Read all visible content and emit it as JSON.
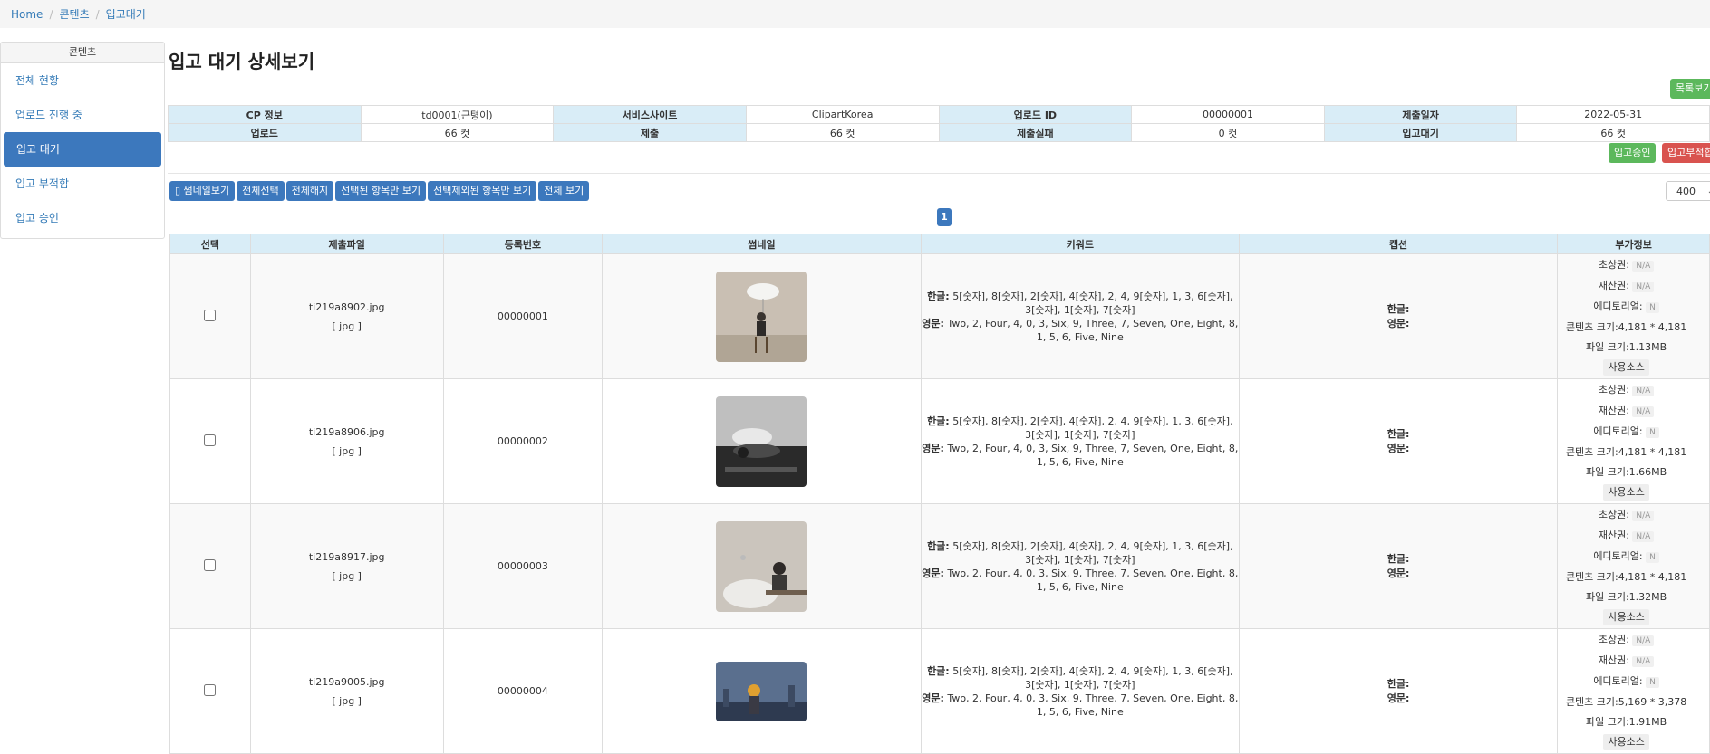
{
  "breadcrumb": {
    "home": "Home",
    "contents": "콘텐츠",
    "current": "입고대기"
  },
  "sidebar": {
    "header": "콘텐츠",
    "items": [
      {
        "label": "전체 현황"
      },
      {
        "label": "업로드 진행 중"
      },
      {
        "label": "입고 대기"
      },
      {
        "label": "입고 부적합"
      },
      {
        "label": "입고 승인"
      }
    ]
  },
  "page": {
    "title": "입고 대기 상세보기",
    "list_button": "목록보기"
  },
  "info": {
    "cp_label": "CP 정보",
    "cp_value": "td0001(근텽이)",
    "site_label": "서비스사이트",
    "site_value": "ClipartKorea",
    "upload_id_label": "업로드 ID",
    "upload_id_value": "00000001",
    "date_label": "제출일자",
    "date_value": "2022-05-31",
    "upload_label": "업로드",
    "upload_value": "66 컷",
    "submit_label": "제출",
    "submit_value": "66 컷",
    "fail_label": "제출실패",
    "fail_value": "0 컷",
    "wait_label": "입고대기",
    "wait_value": "66 컷"
  },
  "actions": {
    "approve": "입고승인",
    "reject": "입고부적합"
  },
  "toolbar": {
    "thumbnail": "▯ 썸네일보기",
    "select_all": "전체선택",
    "deselect_all": "전체해지",
    "show_selected": "선택된 항목만 보기",
    "show_excluded": "선택제외된 항목만 보기",
    "show_all": "전체 보기",
    "page_size": "400"
  },
  "pagination": {
    "current": "1"
  },
  "table": {
    "headers": [
      "선택",
      "제출파일",
      "등록번호",
      "썸네일",
      "키워드",
      "캡션",
      "부가정보"
    ],
    "rows": [
      {
        "file": "ti219a8902.jpg",
        "ext": "[ jpg ]",
        "reg_no": "00000001",
        "kw_ko_label": "한글:",
        "kw_ko": "5[숫자], 8[숫자], 2[숫자], 4[숫자], 2, 4, 9[숫자], 1, 3, 6[숫자], 3[숫자], 1[숫자], 7[숫자]",
        "kw_en_label": "영문:",
        "kw_en": "Two, 2, Four, 4, 0, 3, Six, 9, Three, 7, Seven, One, Eight, 8, 1, 5, 6, Five, Nine",
        "cap_ko": "한글:",
        "cap_en": "영문:",
        "portrait_label": "초상권:",
        "portrait": "N/A",
        "property_label": "재산권:",
        "property": "N/A",
        "editorial_label": "에디토리얼:",
        "editorial": "N",
        "size_label": "콘텐츠 크기:",
        "size": "4,181 * 4,181",
        "filesize_label": "파일 크기:",
        "filesize": "1.13MB",
        "source": "사용소스"
      },
      {
        "file": "ti219a8906.jpg",
        "ext": "[ jpg ]",
        "reg_no": "00000002",
        "kw_ko_label": "한글:",
        "kw_ko": "5[숫자], 8[숫자], 2[숫자], 4[숫자], 2, 4, 9[숫자], 1, 3, 6[숫자], 3[숫자], 1[숫자], 7[숫자]",
        "kw_en_label": "영문:",
        "kw_en": "Two, 2, Four, 4, 0, 3, Six, 9, Three, 7, Seven, One, Eight, 8, 1, 5, 6, Five, Nine",
        "cap_ko": "한글:",
        "cap_en": "영문:",
        "portrait_label": "초상권:",
        "portrait": "N/A",
        "property_label": "재산권:",
        "property": "N/A",
        "editorial_label": "에디토리얼:",
        "editorial": "N",
        "size_label": "콘텐츠 크기:",
        "size": "4,181 * 4,181",
        "filesize_label": "파일 크기:",
        "filesize": "1.66MB",
        "source": "사용소스"
      },
      {
        "file": "ti219a8917.jpg",
        "ext": "[ jpg ]",
        "reg_no": "00000003",
        "kw_ko_label": "한글:",
        "kw_ko": "5[숫자], 8[숫자], 2[숫자], 4[숫자], 2, 4, 9[숫자], 1, 3, 6[숫자], 3[숫자], 1[숫자], 7[숫자]",
        "kw_en_label": "영문:",
        "kw_en": "Two, 2, Four, 4, 0, 3, Six, 9, Three, 7, Seven, One, Eight, 8, 1, 5, 6, Five, Nine",
        "cap_ko": "한글:",
        "cap_en": "영문:",
        "portrait_label": "초상권:",
        "portrait": "N/A",
        "property_label": "재산권:",
        "property": "N/A",
        "editorial_label": "에디토리얼:",
        "editorial": "N",
        "size_label": "콘텐츠 크기:",
        "size": "4,181 * 4,181",
        "filesize_label": "파일 크기:",
        "filesize": "1.32MB",
        "source": "사용소스"
      },
      {
        "file": "ti219a9005.jpg",
        "ext": "[ jpg ]",
        "reg_no": "00000004",
        "kw_ko_label": "한글:",
        "kw_ko": "5[숫자], 8[숫자], 2[숫자], 4[숫자], 2, 4, 9[숫자], 1, 3, 6[숫자], 3[숫자], 1[숫자], 7[숫자]",
        "kw_en_label": "영문:",
        "kw_en": "Two, 2, Four, 4, 0, 3, Six, 9, Three, 7, Seven, One, Eight, 8, 1, 5, 6, Five, Nine",
        "cap_ko": "한글:",
        "cap_en": "영문:",
        "portrait_label": "초상권:",
        "portrait": "N/A",
        "property_label": "재산권:",
        "property": "N/A",
        "editorial_label": "에디토리얼:",
        "editorial": "N",
        "size_label": "콘텐츠 크기:",
        "size": "5,169 * 3,378",
        "filesize_label": "파일 크기:",
        "filesize": "1.91MB",
        "source": "사용소스"
      }
    ]
  },
  "colors": {
    "primary": "#3c78bd",
    "success": "#5cb85c",
    "danger": "#d9534f",
    "header_bg": "#d9edf7"
  }
}
